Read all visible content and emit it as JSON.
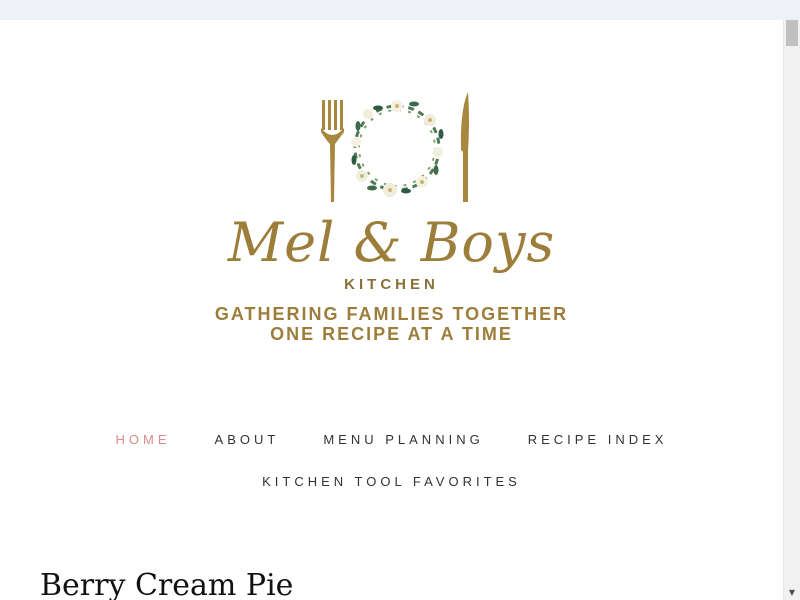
{
  "site": {
    "logo_name": "Mel & Boys",
    "logo_sub": "KITCHEN",
    "tagline_line1": "GATHERING FAMILIES TOGETHER",
    "tagline_line2": "ONE RECIPE AT A TIME"
  },
  "nav": {
    "items": [
      {
        "label": "HOME",
        "active": true
      },
      {
        "label": "ABOUT"
      },
      {
        "label": "MENU PLANNING"
      },
      {
        "label": "RECIPE INDEX"
      },
      {
        "label": "KITCHEN TOOL FAVORITES"
      }
    ]
  },
  "post": {
    "title": "Berry Cream Pie"
  },
  "colors": {
    "gold": "#9c7e3a",
    "nav_active": "#d98a8a",
    "nav_text": "#333333",
    "topbar": "#eef2f7"
  },
  "icons": {
    "fork": "fork-icon",
    "knife": "knife-icon",
    "wreath": "floral-wreath-icon"
  }
}
